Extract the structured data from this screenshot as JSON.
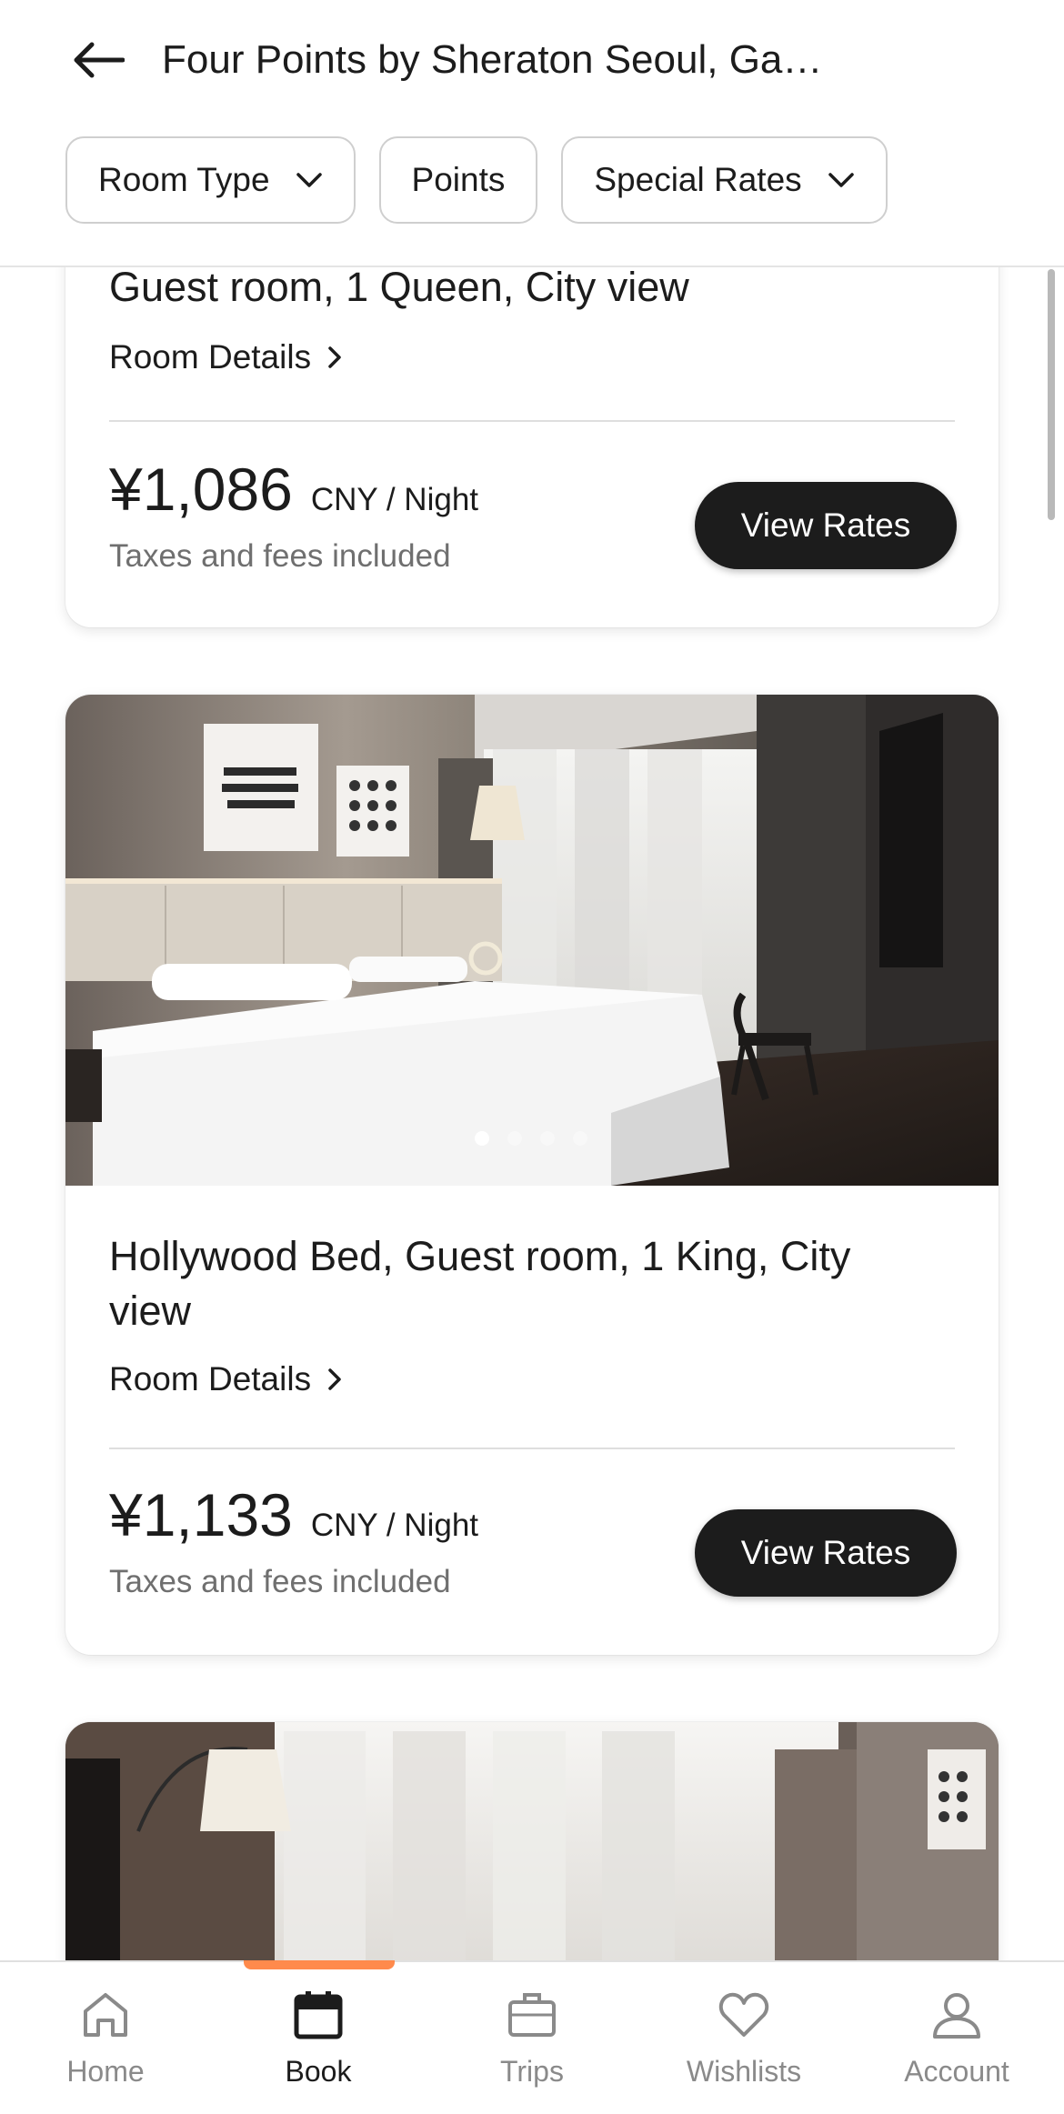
{
  "header": {
    "title": "Four Points by Sheraton Seoul, Ga…",
    "back_icon": "arrow-left-icon"
  },
  "filters": [
    {
      "label": "Room Type",
      "has_dropdown": true
    },
    {
      "label": "Points",
      "has_dropdown": false
    },
    {
      "label": "Special Rates",
      "has_dropdown": true
    }
  ],
  "rooms": [
    {
      "name": "Guest room, 1 Queen, City view",
      "details_label": "Room Details",
      "price": "¥1,086",
      "price_unit": "CNY / Night",
      "taxes_note": "Taxes and fees included",
      "cta": "View Rates"
    },
    {
      "name": "Hollywood Bed, Guest room, 1 King, City view",
      "details_label": "Room Details",
      "price": "¥1,133",
      "price_unit": "CNY / Night",
      "taxes_note": "Taxes and fees included",
      "cta": "View Rates",
      "photo_pages": 4,
      "photo_current": 1
    }
  ],
  "nav": {
    "items": [
      {
        "label": "Home",
        "icon": "home-icon",
        "active": false
      },
      {
        "label": "Book",
        "icon": "calendar-icon",
        "active": true
      },
      {
        "label": "Trips",
        "icon": "suitcase-icon",
        "active": false
      },
      {
        "label": "Wishlists",
        "icon": "heart-icon",
        "active": false
      },
      {
        "label": "Account",
        "icon": "person-icon",
        "active": false
      }
    ]
  },
  "colors": {
    "accent": "#ff8a4c",
    "button_dark": "#1c1c1c",
    "muted_text": "#6f6f6f"
  }
}
